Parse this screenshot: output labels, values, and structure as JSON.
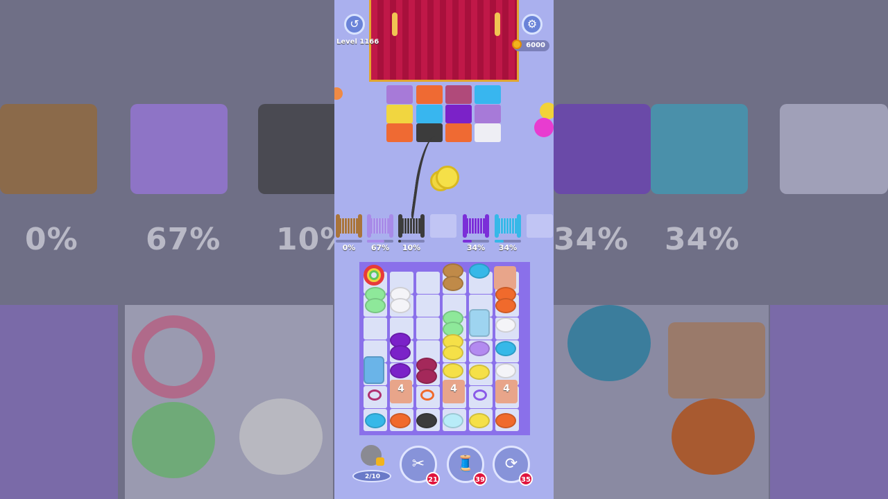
{
  "hud": {
    "level": "Level 1166",
    "coins": "6000"
  },
  "rack": [
    {
      "color": "#a9743a",
      "pct": "0%",
      "fill": 0.0
    },
    {
      "color": "#a88be8",
      "pct": "67%",
      "fill": 0.67
    },
    {
      "color": "#3c3c3c",
      "pct": "10%",
      "fill": 0.1
    },
    {
      "color": "",
      "pct": "",
      "fill": 0
    },
    {
      "color": "#7b2ed8",
      "pct": "34%",
      "fill": 0.34
    },
    {
      "color": "#36b8e8",
      "pct": "34%",
      "fill": 0.34
    },
    {
      "color": "",
      "pct": "",
      "fill": 0
    }
  ],
  "board": {
    "box_label": "4"
  },
  "powerups": {
    "ball_progress": "2/10",
    "scissors": "21",
    "spool": "39",
    "magnet": "35"
  },
  "background": {
    "pct": [
      "0%",
      "67%",
      "10%",
      "34%",
      "34%"
    ]
  },
  "colors": {
    "bg": "#aab0ee",
    "board": "#8a70ea",
    "curtain": "#c01848"
  }
}
